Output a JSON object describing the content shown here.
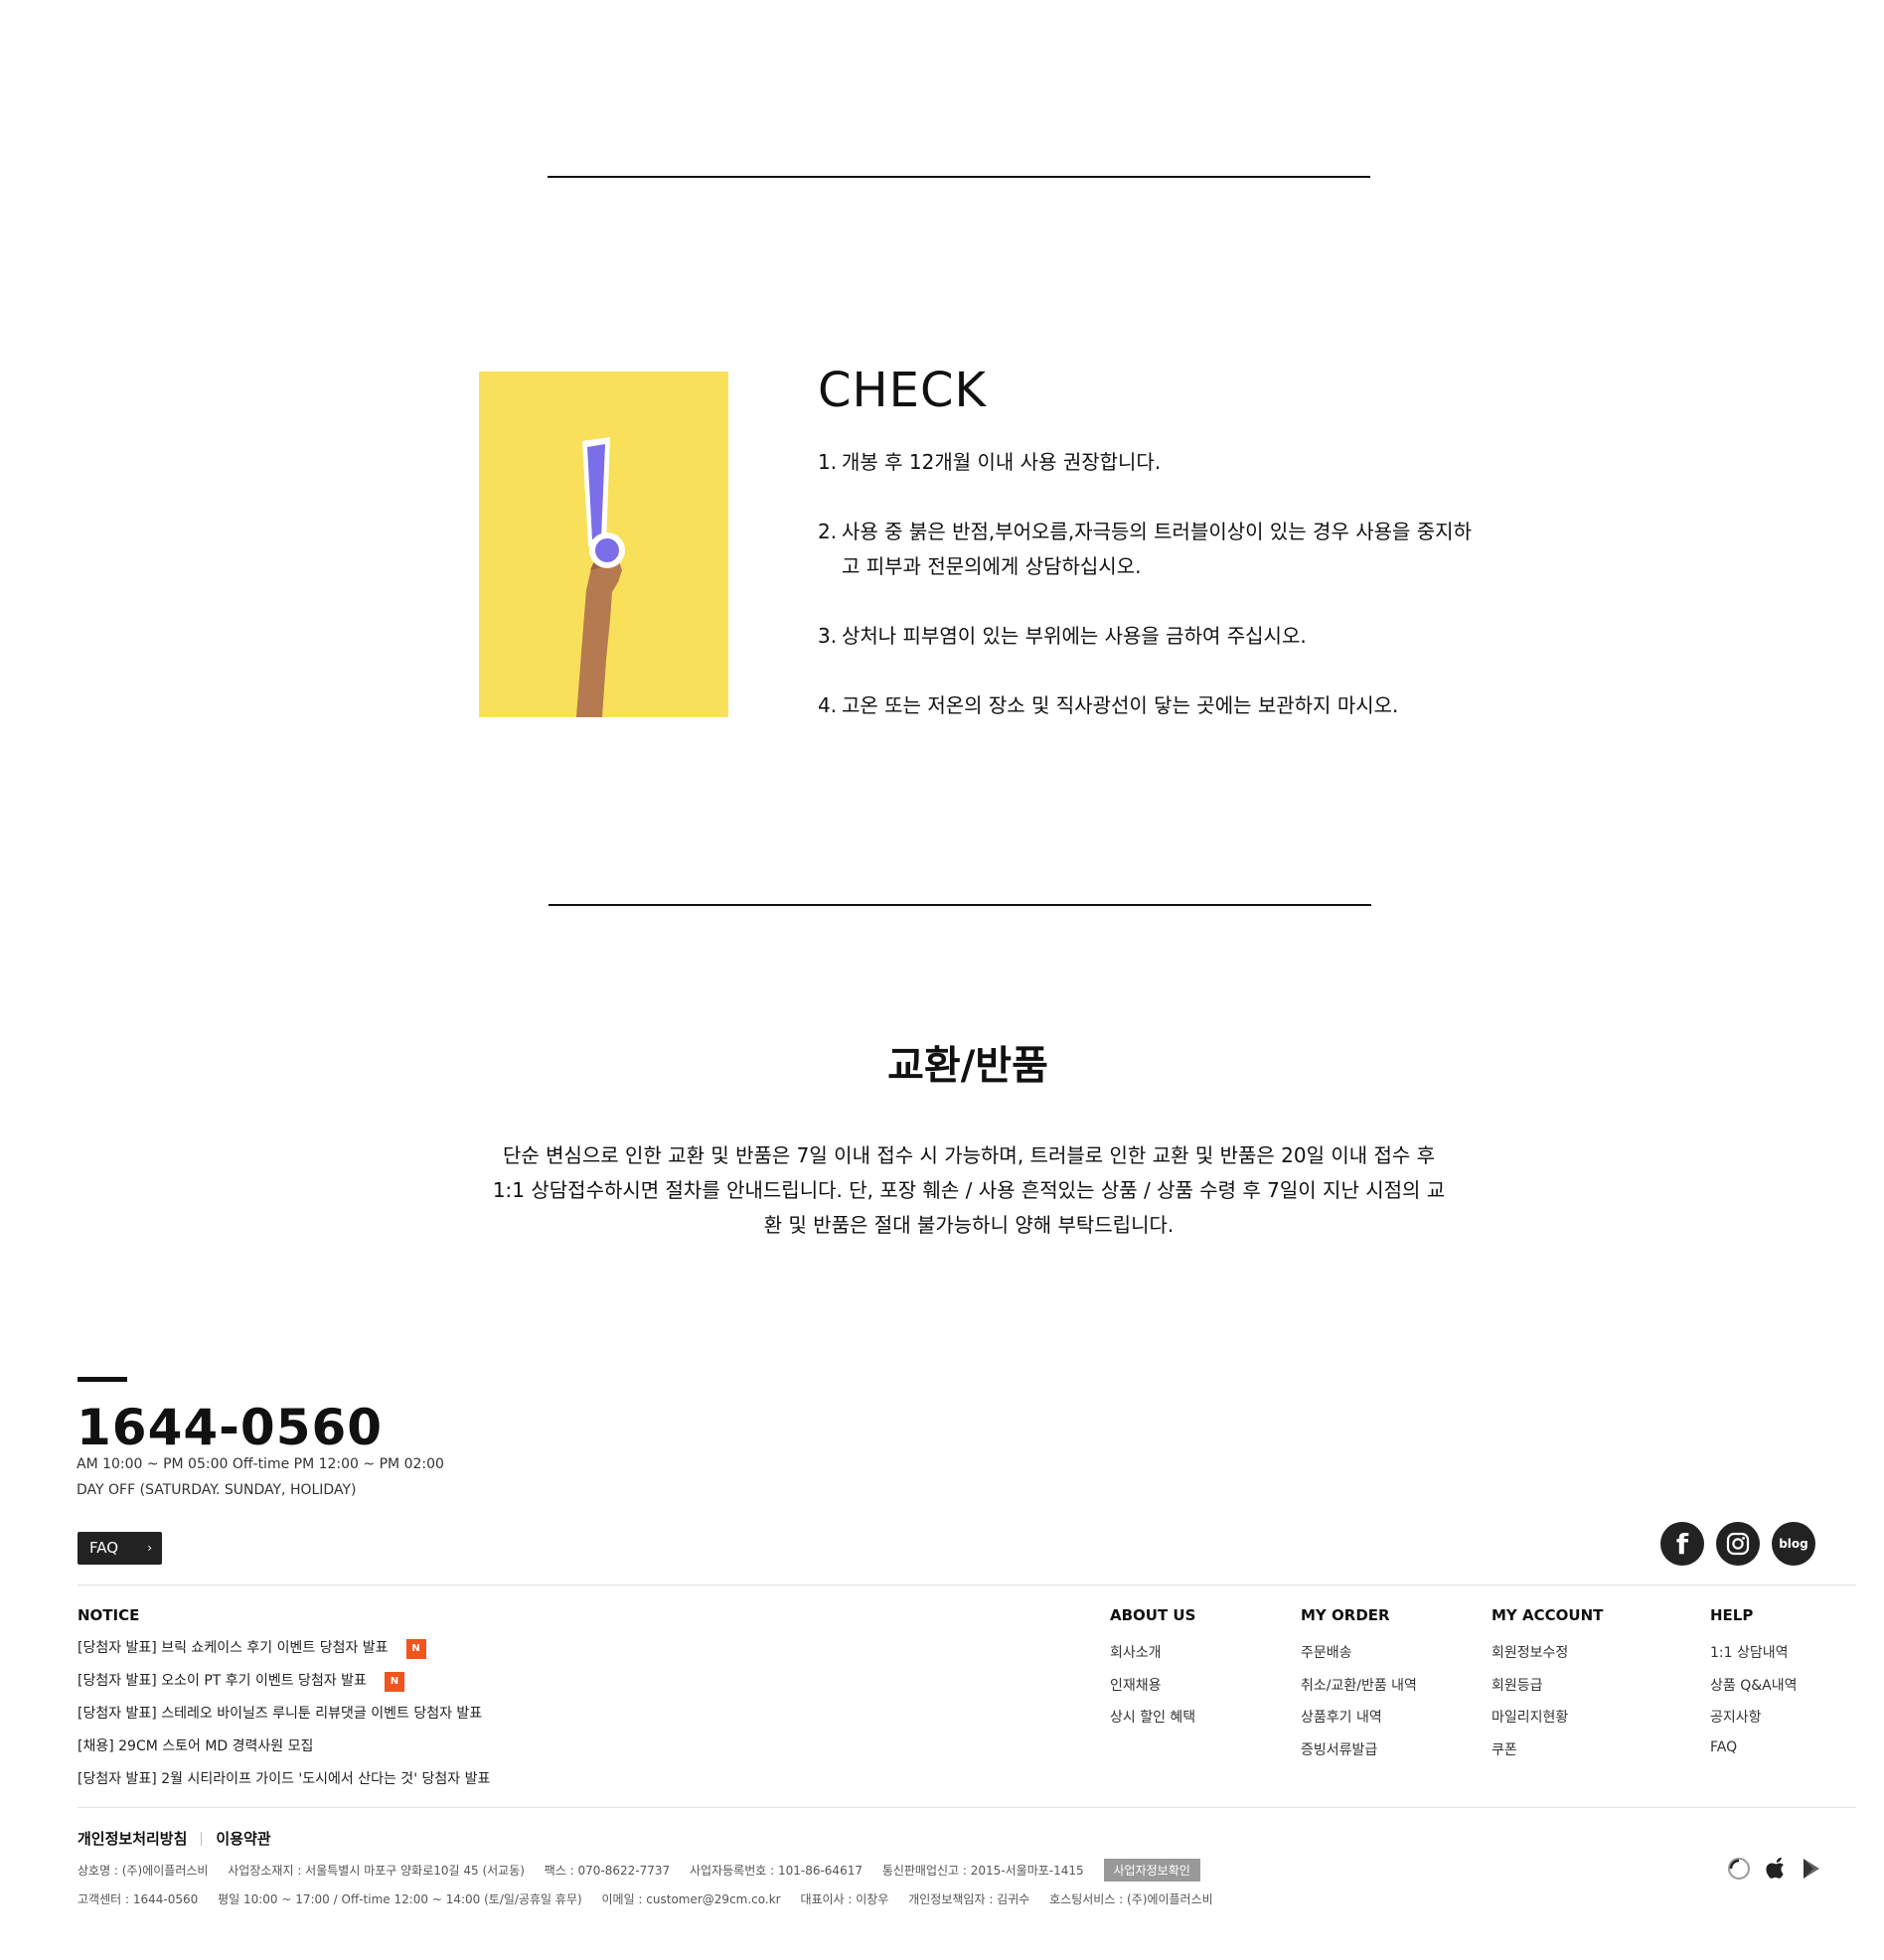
{
  "check": {
    "title": "CHECK",
    "items": [
      {
        "num": "1.",
        "text": "개봉 후 12개월 이내 사용 권장합니다."
      },
      {
        "num": "2.",
        "text": "사용 중 붉은 반점,부어오름,자극등의 트러블이상이 있는 경우 사용을 중지하고 피부과 전문의에게 상담하십시오."
      },
      {
        "num": "3.",
        "text": "상처나 피부염이 있는 부위에는 사용을 금하여 주십시오."
      },
      {
        "num": "4.",
        "text": "고온 또는 저온의 장소 및 직사광선이 닿는 곳에는 보관하지 마시오."
      }
    ]
  },
  "exchange": {
    "title": "교환/반품",
    "body": "단순 변심으로 인한 교환 및 반품은 7일 이내 접수 시 가능하며, 트러블로 인한 교환 및 반품은 20일 이내 접수 후 1:1 상담접수하시면 절차를 안내드립니다. 단, 포장 훼손 / 사용 흔적있는 상품 / 상품 수령 후 7일이 지난 시점의 교환 및 반품은 절대 불가능하니 양해 부탁드립니다."
  },
  "footer": {
    "phone": "1644-0560",
    "hours": "AM 10:00 ~ PM 05:00 Off-time PM 12:00 ~ PM 02:00",
    "dayoff": "DAY OFF (SATURDAY. SUNDAY, HOLIDAY)",
    "faq_label": "FAQ",
    "social": {
      "facebook": "f",
      "instagram": "instagram-icon",
      "blog": "blog"
    },
    "notice": {
      "title": "NOTICE",
      "badge": "N",
      "items": [
        "[당첨자 발표] 브릭 쇼케이스 후기 이벤트 당첨자 발표",
        "[당첨자 발표] 오소이 PT 후기 이벤트 당첨자 발표",
        "[당첨자 발표] 스테레오 바이닐즈 루니툰 리뷰댓글 이벤트 당첨자 발표",
        "[채용] 29CM 스토어 MD 경력사원 모집",
        "[당첨자 발표] 2월 시티라이프 가이드 '도시에서 산다는 것' 당첨자 발표"
      ]
    },
    "columns": [
      {
        "title": "ABOUT US",
        "links": [
          "회사소개",
          "인재채용",
          "상시 할인 혜택"
        ]
      },
      {
        "title": "MY ORDER",
        "links": [
          "주문배송",
          "취소/교환/반품 내역",
          "상품후기 내역",
          "증빙서류발급"
        ]
      },
      {
        "title": "MY ACCOUNT",
        "links": [
          "회원정보수정",
          "회원등급",
          "마일리지현황",
          "쿠폰"
        ]
      },
      {
        "title": "HELP",
        "links": [
          "1:1 상담내역",
          "상품 Q&A내역",
          "공지사항",
          "FAQ"
        ]
      }
    ],
    "legal": {
      "privacy": "개인정보처리방침",
      "terms": "이용약관"
    },
    "biz_line1": [
      "상호명 : (주)에이플러스비",
      "사업장소재지 : 서울특별시 마포구 양화로10길 45 (서교동)",
      "팩스 : 070-8622-7737",
      "사업자등록번호 : 101-86-64617",
      "통신판매업신고 : 2015-서울마포-1415"
    ],
    "biz_button": "사업자정보확인",
    "biz_line2": [
      "고객센터 : 1644-0560",
      "평일 10:00 ~ 17:00 / Off-time 12:00 ~ 14:00 (토/일/공휴일 휴무)",
      "이메일 : customer@29cm.co.kr",
      "대표이사 : 이창우",
      "개인정보책임자 : 김귀수",
      "호스팅서비스 : (주)에이플러스비"
    ]
  },
  "colors": {
    "accent_badge": "#f2541d",
    "image_bg": "#f9e05a",
    "exclamation": "#7b6ee8"
  }
}
